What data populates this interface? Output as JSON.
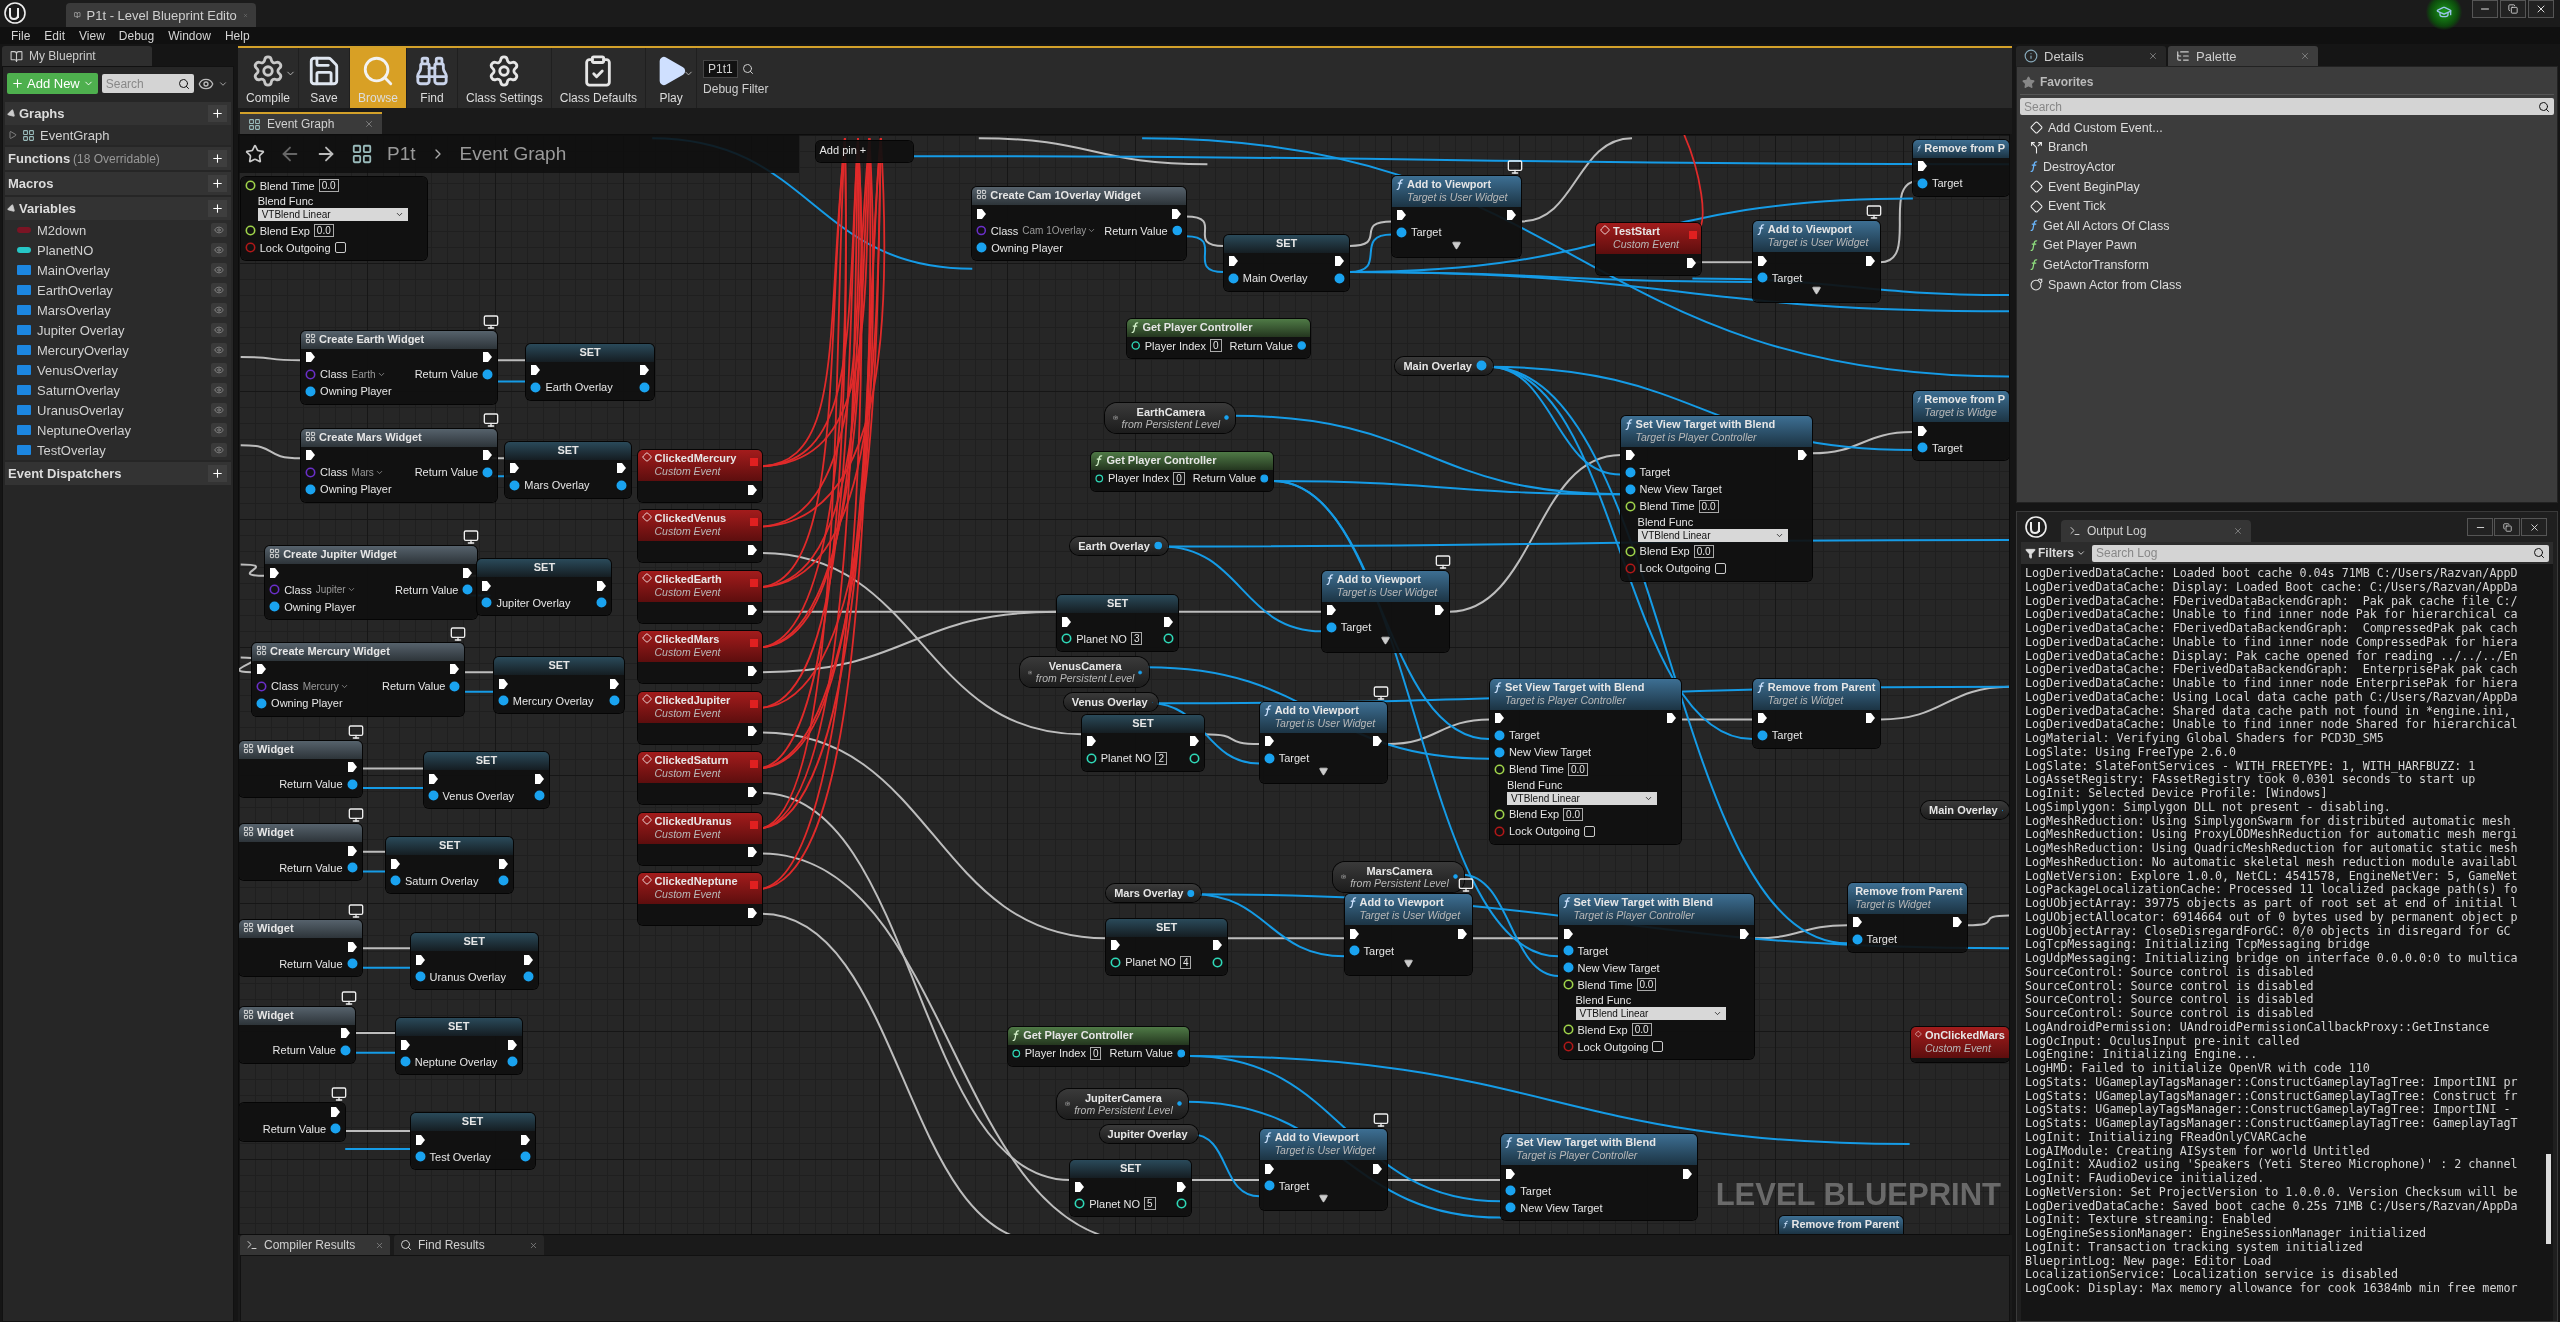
{
  "window": {
    "tab": "P1t - Level Blueprint Edito"
  },
  "menu": [
    "File",
    "Edit",
    "View",
    "Debug",
    "Window",
    "Help"
  ],
  "my_blueprint": {
    "tab": "My Blueprint",
    "add_new": "Add New",
    "search_placeholder": "Search",
    "sections": [
      {
        "title": "Graphs",
        "expanded": true,
        "items": [
          {
            "name": "EventGraph",
            "expanded": false
          }
        ]
      },
      {
        "title": "Functions",
        "note": "(18 Overridable)"
      },
      {
        "title": "Macros"
      },
      {
        "title": "Variables",
        "expanded": true,
        "variables": [
          {
            "name": "M2down",
            "kind": "pill",
            "color": "#7a1424"
          },
          {
            "name": "PlanetNO",
            "kind": "pill",
            "color": "#26c6c6"
          },
          {
            "name": "MainOverlay",
            "kind": "square",
            "color": "#1c86e0"
          },
          {
            "name": "EarthOverlay",
            "kind": "square",
            "color": "#1c86e0"
          },
          {
            "name": "MarsOverlay",
            "kind": "square",
            "color": "#1c86e0"
          },
          {
            "name": "Jupiter Overlay",
            "kind": "square",
            "color": "#1c86e0"
          },
          {
            "name": "MercuryOverlay",
            "kind": "square",
            "color": "#1c86e0"
          },
          {
            "name": "VenusOverlay",
            "kind": "square",
            "color": "#1c86e0"
          },
          {
            "name": "SaturnOverlay",
            "kind": "square",
            "color": "#1c86e0"
          },
          {
            "name": "UranusOverlay",
            "kind": "square",
            "color": "#1c86e0"
          },
          {
            "name": "NeptuneOverlay",
            "kind": "square",
            "color": "#1c86e0"
          },
          {
            "name": "TestOverlay",
            "kind": "square",
            "color": "#1c86e0"
          }
        ]
      },
      {
        "title": "Event Dispatchers"
      }
    ]
  },
  "toolbar": [
    {
      "label": "Compile",
      "kind": "compile",
      "selected": false,
      "menu": true
    },
    {
      "label": "Save",
      "kind": "save",
      "selected": false
    },
    {
      "label": "Browse",
      "kind": "browse",
      "selected": true
    },
    {
      "label": "Find",
      "kind": "find",
      "selected": false
    },
    {
      "label": "Class Settings",
      "kind": "settings",
      "selected": false
    },
    {
      "label": "Class Defaults",
      "kind": "defaults",
      "selected": false
    },
    {
      "label": "Play",
      "kind": "play",
      "selected": false,
      "menu": true
    }
  ],
  "debug_filter": {
    "value": "P1t1",
    "label": "Debug Filter"
  },
  "graph_tab": "Event Graph",
  "breadcrumb": [
    "P1t",
    "Event Graph"
  ],
  "nodes": [
    {
      "kind": "fragment",
      "rows": [
        {
          "in": {
            "label": "Blend Time",
            "kind": "float",
            "value": "0.0"
          }
        },
        {
          "in": {
            "label": "Blend Func",
            "kind": "enum",
            "value": "VTBlend Linear"
          }
        },
        {
          "in": {
            "label": "Blend Exp",
            "kind": "float",
            "value": "0.0"
          }
        },
        {
          "in": {
            "label": "Lock Outgoing",
            "kind": "bool",
            "checked": false
          }
        }
      ]
    },
    {
      "kind": "create",
      "title": "Create Earth Widget",
      "monitor": true,
      "exec_in": true,
      "exec_out": true,
      "rows": [
        {
          "in": {
            "label": "Class",
            "kind": "class",
            "value": "Earth"
          },
          "out": {
            "label": "Return Value",
            "kind": "object"
          }
        },
        {
          "in": {
            "label": "Owning Player",
            "kind": "object"
          }
        }
      ]
    },
    {
      "kind": "set",
      "title": "SET",
      "exec_in": true,
      "exec_out": true,
      "rows": [
        {
          "in": {
            "label": "Earth Overlay",
            "kind": "object"
          },
          "out": {
            "kind": "object"
          }
        }
      ]
    },
    {
      "kind": "create",
      "title": "Create Mars Widget",
      "monitor": true,
      "exec_in": true,
      "exec_out": true,
      "rows": [
        {
          "in": {
            "label": "Class",
            "kind": "class",
            "value": "Mars"
          },
          "out": {
            "label": "Return Value",
            "kind": "object"
          }
        },
        {
          "in": {
            "label": "Owning Player",
            "kind": "object"
          }
        }
      ]
    },
    {
      "kind": "set",
      "title": "SET",
      "exec_in": true,
      "exec_out": true,
      "rows": [
        {
          "in": {
            "label": "Mars Overlay",
            "kind": "object"
          },
          "out": {
            "kind": "object"
          }
        }
      ]
    },
    {
      "kind": "create",
      "title": "Create Jupiter Widget",
      "monitor": true,
      "exec_in": true,
      "exec_out": true,
      "rows": [
        {
          "in": {
            "label": "Class",
            "kind": "class",
            "value": "Jupiter"
          },
          "out": {
            "label": "Return Value",
            "kind": "object"
          }
        },
        {
          "in": {
            "label": "Owning Player",
            "kind": "object"
          }
        }
      ]
    },
    {
      "kind": "set",
      "title": "SET",
      "exec_in": true,
      "exec_out": true,
      "rows": [
        {
          "in": {
            "label": "Jupiter Overlay",
            "kind": "object"
          },
          "out": {
            "kind": "object"
          }
        }
      ]
    },
    {
      "kind": "create",
      "title": "Create Mercury Widget",
      "monitor": true,
      "exec_in": true,
      "exec_out": true,
      "rows": [
        {
          "in": {
            "label": "Class",
            "kind": "class",
            "value": "Mercury"
          },
          "out": {
            "label": "Return Value",
            "kind": "object"
          }
        },
        {
          "in": {
            "label": "Owning Player",
            "kind": "object"
          }
        }
      ]
    },
    {
      "kind": "set",
      "title": "SET",
      "exec_in": true,
      "exec_out": true,
      "rows": [
        {
          "in": {
            "label": "Mercury Overlay",
            "kind": "object"
          },
          "out": {
            "kind": "object"
          }
        }
      ]
    },
    {
      "kind": "create",
      "title": "Widget",
      "monitor": true,
      "exec_in": false,
      "exec_out": true,
      "rows": [
        {
          "out": {
            "label": "Return Value",
            "kind": "object"
          }
        }
      ]
    },
    {
      "kind": "set",
      "title": "SET",
      "exec_in": true,
      "exec_out": true,
      "rows": [
        {
          "in": {
            "label": "Venus Overlay",
            "kind": "object"
          },
          "out": {
            "kind": "object"
          }
        }
      ]
    },
    {
      "kind": "create",
      "title": "Widget",
      "monitor": true,
      "exec_in": false,
      "exec_out": true,
      "rows": [
        {
          "out": {
            "label": "Return Value",
            "kind": "object"
          }
        }
      ]
    },
    {
      "kind": "set",
      "title": "SET",
      "exec_in": true,
      "exec_out": true,
      "rows": [
        {
          "in": {
            "label": "Saturn Overlay",
            "kind": "object"
          },
          "out": {
            "kind": "object"
          }
        }
      ]
    },
    {
      "kind": "create",
      "title": "Widget",
      "monitor": true,
      "exec_in": false,
      "exec_out": true,
      "rows": [
        {
          "out": {
            "label": "Return Value",
            "kind": "object"
          }
        }
      ]
    },
    {
      "kind": "set",
      "title": "SET",
      "exec_in": true,
      "exec_out": true,
      "rows": [
        {
          "in": {
            "label": "Uranus Overlay",
            "kind": "object"
          },
          "out": {
            "kind": "object"
          }
        }
      ]
    },
    {
      "kind": "create",
      "title": "Widget",
      "monitor": true,
      "exec_in": false,
      "exec_out": true,
      "rows": [
        {
          "out": {
            "label": "Return Value",
            "kind": "object"
          }
        }
      ]
    },
    {
      "kind": "set",
      "title": "SET",
      "exec_in": true,
      "exec_out": true,
      "rows": [
        {
          "in": {
            "label": "Neptune Overlay",
            "kind": "object"
          },
          "out": {
            "kind": "object"
          }
        }
      ]
    },
    {
      "kind": "fragment",
      "monitor": true,
      "exec_out": true,
      "rows": [
        {
          "out": {
            "label": "Return Value",
            "kind": "object"
          }
        }
      ]
    },
    {
      "kind": "set",
      "title": "SET",
      "exec_in": true,
      "exec_out": true,
      "rows": [
        {
          "in": {
            "label": "Test Overlay",
            "kind": "object"
          },
          "out": {
            "kind": "object"
          }
        }
      ]
    },
    {
      "kind": "event",
      "title": "ClickedMercury",
      "subtitle": "Custom Event",
      "exec_out": true
    },
    {
      "kind": "event",
      "title": "ClickedVenus",
      "subtitle": "Custom Event",
      "exec_out": true
    },
    {
      "kind": "event",
      "title": "ClickedEarth",
      "subtitle": "Custom Event",
      "exec_out": true
    },
    {
      "kind": "event",
      "title": "ClickedMars",
      "subtitle": "Custom Event",
      "exec_out": true
    },
    {
      "kind": "event",
      "title": "ClickedJupiter",
      "subtitle": "Custom Event",
      "exec_out": true
    },
    {
      "kind": "event",
      "title": "ClickedSaturn",
      "subtitle": "Custom Event",
      "exec_out": true
    },
    {
      "kind": "event",
      "title": "ClickedUranus",
      "subtitle": "Custom Event",
      "exec_out": true
    },
    {
      "kind": "event",
      "title": "ClickedNeptune",
      "subtitle": "Custom Event",
      "exec_out": true
    },
    {
      "kind": "fragment",
      "rows": [
        {
          "in": {
            "label": "Add pin +"
          }
        }
      ]
    },
    {
      "kind": "create",
      "title": "Create Cam 1Overlay Widget",
      "monitor": false,
      "exec_in": true,
      "exec_out": true,
      "rows": [
        {
          "in": {
            "label": "Class",
            "kind": "class",
            "value": "Cam 1Overlay"
          },
          "out": {
            "label": "Return Value",
            "kind": "object"
          }
        },
        {
          "in": {
            "label": "Owning Player",
            "kind": "object"
          }
        }
      ]
    },
    {
      "kind": "set",
      "title": "SET",
      "exec_in": true,
      "exec_out": true,
      "rows": [
        {
          "in": {
            "label": "Main Overlay",
            "kind": "object"
          },
          "out": {
            "kind": "object"
          }
        }
      ]
    },
    {
      "kind": "func",
      "title": "Add to Viewport",
      "subtitle": "Target is User Widget",
      "monitor": true,
      "advanced": true,
      "exec_in": true,
      "exec_out": true,
      "rows": [
        {
          "in": {
            "label": "Target",
            "kind": "object"
          }
        }
      ]
    },
    {
      "kind": "event",
      "title": "TestStart",
      "subtitle": "Custom Event",
      "exec_out": true
    },
    {
      "kind": "func",
      "title": "Add to Viewport",
      "subtitle": "Target is User Widget",
      "monitor": true,
      "advanced": true,
      "exec_in": true,
      "exec_out": true,
      "rows": [
        {
          "in": {
            "label": "Target",
            "kind": "object"
          }
        }
      ]
    },
    {
      "kind": "func",
      "title": "Remove from P",
      "exec_in": true,
      "exec_out": false,
      "rows": [
        {
          "in": {
            "label": "Target",
            "kind": "object"
          }
        }
      ]
    },
    {
      "kind": "pure",
      "title": "Get Player Controller",
      "rows": [
        {
          "in": {
            "label": "Player Index",
            "kind": "int",
            "value": "0"
          },
          "out": {
            "label": "Return Value",
            "kind": "object"
          }
        }
      ]
    },
    {
      "kind": "var",
      "title": "Main Overlay"
    },
    {
      "kind": "var",
      "title": "EarthCamera",
      "subtitle": "from Persistent Level"
    },
    {
      "kind": "pure",
      "title": "Get Player Controller",
      "rows": [
        {
          "in": {
            "label": "Player Index",
            "kind": "int",
            "value": "0"
          },
          "out": {
            "label": "Return Value",
            "kind": "object"
          }
        }
      ]
    },
    {
      "kind": "func",
      "title": "Set View Target with Blend",
      "subtitle": "Target is Player Controller",
      "exec_in": true,
      "exec_out": true,
      "rows": [
        {
          "in": {
            "label": "Target",
            "kind": "object"
          }
        },
        {
          "in": {
            "label": "New View Target",
            "kind": "object"
          }
        },
        {
          "in": {
            "label": "Blend Time",
            "kind": "float",
            "value": "0.0"
          }
        },
        {
          "in": {
            "label": "Blend Func",
            "kind": "enum",
            "value": "VTBlend Linear"
          }
        },
        {
          "in": {
            "label": "Blend Exp",
            "kind": "float",
            "value": "0.0"
          }
        },
        {
          "in": {
            "label": "Lock Outgoing",
            "kind": "bool",
            "checked": false
          }
        }
      ]
    },
    {
      "kind": "func",
      "title": "Remove from P",
      "subtitle": "Target is Widge",
      "exec_in": true,
      "exec_out": false,
      "rows": [
        {
          "in": {
            "label": "Target",
            "kind": "object"
          }
        }
      ]
    },
    {
      "kind": "var",
      "title": "Earth Overlay"
    },
    {
      "kind": "set",
      "title": "SET",
      "exec_in": true,
      "exec_out": true,
      "rows": [
        {
          "in": {
            "label": "Planet NO",
            "kind": "int",
            "value": "3"
          },
          "out": {
            "kind": "int"
          }
        }
      ]
    },
    {
      "kind": "func",
      "title": "Add to Viewport",
      "subtitle": "Target is User Widget",
      "monitor": true,
      "advanced": true,
      "exec_in": true,
      "exec_out": true,
      "rows": [
        {
          "in": {
            "label": "Target",
            "kind": "object"
          }
        }
      ]
    },
    {
      "kind": "var",
      "title": "VenusCamera",
      "subtitle": "from Persistent Level"
    },
    {
      "kind": "var",
      "title": "Venus Overlay"
    },
    {
      "kind": "set",
      "title": "SET",
      "exec_in": true,
      "exec_out": true,
      "rows": [
        {
          "in": {
            "label": "Planet NO",
            "kind": "int",
            "value": "2"
          },
          "out": {
            "kind": "int"
          }
        }
      ]
    },
    {
      "kind": "func",
      "title": "Add to Viewport",
      "subtitle": "Target is User Widget",
      "monitor": true,
      "advanced": true,
      "exec_in": true,
      "exec_out": true,
      "rows": [
        {
          "in": {
            "label": "Target",
            "kind": "object"
          }
        }
      ]
    },
    {
      "kind": "func",
      "title": "Set View Target with Blend",
      "subtitle": "Target is Player Controller",
      "exec_in": true,
      "exec_out": true,
      "rows": [
        {
          "in": {
            "label": "Target",
            "kind": "object"
          }
        },
        {
          "in": {
            "label": "New View Target",
            "kind": "object"
          }
        },
        {
          "in": {
            "label": "Blend Time",
            "kind": "float",
            "value": "0.0"
          }
        },
        {
          "in": {
            "label": "Blend Func",
            "kind": "enum",
            "value": "VTBlend Linear"
          }
        },
        {
          "in": {
            "label": "Blend Exp",
            "kind": "float",
            "value": "0.0"
          }
        },
        {
          "in": {
            "label": "Lock Outgoing",
            "kind": "bool",
            "checked": false
          }
        }
      ]
    },
    {
      "kind": "func",
      "title": "Remove from Parent",
      "subtitle": "Target is Widget",
      "exec_in": true,
      "exec_out": true,
      "rows": [
        {
          "in": {
            "label": "Target",
            "kind": "object"
          }
        }
      ]
    },
    {
      "kind": "var",
      "title": "Main Overlay"
    },
    {
      "kind": "var",
      "title": "MarsCamera",
      "subtitle": "from Persistent Level"
    },
    {
      "kind": "var",
      "title": "Mars Overlay"
    },
    {
      "kind": "set",
      "title": "SET",
      "exec_in": true,
      "exec_out": true,
      "rows": [
        {
          "in": {
            "label": "Planet NO",
            "kind": "int",
            "value": "4"
          },
          "out": {
            "kind": "int"
          }
        }
      ]
    },
    {
      "kind": "func",
      "title": "Add to Viewport",
      "subtitle": "Target is User Widget",
      "monitor": true,
      "advanced": true,
      "exec_in": true,
      "exec_out": true,
      "rows": [
        {
          "in": {
            "label": "Target",
            "kind": "object"
          }
        }
      ]
    },
    {
      "kind": "func",
      "title": "Set View Target with Blend",
      "subtitle": "Target is Player Controller",
      "exec_in": true,
      "exec_out": true,
      "rows": [
        {
          "in": {
            "label": "Target",
            "kind": "object"
          }
        },
        {
          "in": {
            "label": "New View Target",
            "kind": "object"
          }
        },
        {
          "in": {
            "label": "Blend Time",
            "kind": "float",
            "value": "0.0"
          }
        },
        {
          "in": {
            "label": "Blend Func",
            "kind": "enum",
            "value": "VTBlend Linear"
          }
        },
        {
          "in": {
            "label": "Blend Exp",
            "kind": "float",
            "value": "0.0"
          }
        },
        {
          "in": {
            "label": "Lock Outgoing",
            "kind": "bool",
            "checked": false
          }
        }
      ]
    },
    {
      "kind": "func",
      "title": "Remove from Parent",
      "subtitle": "Target is Widget",
      "exec_in": true,
      "exec_out": true,
      "rows": [
        {
          "in": {
            "label": "Target",
            "kind": "object"
          }
        }
      ]
    },
    {
      "kind": "pure",
      "title": "Get Player Controller",
      "rows": [
        {
          "in": {
            "label": "Player Index",
            "kind": "int",
            "value": "0"
          },
          "out": {
            "label": "Return Value",
            "kind": "object"
          }
        }
      ]
    },
    {
      "kind": "event",
      "title": "OnClickedMars",
      "subtitle": "Custom Event"
    },
    {
      "kind": "var",
      "title": "JupiterCamera",
      "subtitle": "from Persistent Level"
    },
    {
      "kind": "var",
      "title": "Jupiter Overlay"
    },
    {
      "kind": "set",
      "title": "SET",
      "exec_in": true,
      "exec_out": true,
      "rows": [
        {
          "in": {
            "label": "Planet NO",
            "kind": "int",
            "value": "5"
          },
          "out": {
            "kind": "int"
          }
        }
      ]
    },
    {
      "kind": "func",
      "title": "Add to Viewport",
      "subtitle": "Target is User Widget",
      "monitor": true,
      "advanced": true,
      "exec_in": true,
      "exec_out": true,
      "rows": [
        {
          "in": {
            "label": "Target",
            "kind": "object"
          }
        }
      ]
    },
    {
      "kind": "func",
      "title": "Set View Target with Blend",
      "subtitle": "Target is Player Controller",
      "exec_in": true,
      "exec_out": true,
      "rows": [
        {
          "in": {
            "label": "Target",
            "kind": "object"
          }
        },
        {
          "in": {
            "label": "New View Target",
            "kind": "object"
          }
        }
      ]
    },
    {
      "kind": "func",
      "title": "Remove from Parent"
    }
  ],
  "graph_label": "LEVEL BLUEPRINT",
  "bottom_tabs": [
    {
      "label": "Compiler Results",
      "selected": true
    },
    {
      "label": "Find Results",
      "selected": false
    }
  ],
  "right_tabs": [
    {
      "label": "Details",
      "selected": false
    },
    {
      "label": "Palette",
      "selected": true
    }
  ],
  "palette": {
    "header": "Favorites",
    "search_placeholder": "Search",
    "items": [
      {
        "label": "Add Custom Event...",
        "kind": "event"
      },
      {
        "label": "Branch",
        "kind": "branch"
      },
      {
        "label": "DestroyActor",
        "kind": "function"
      },
      {
        "label": "Event BeginPlay",
        "kind": "event"
      },
      {
        "label": "Event Tick",
        "kind": "event"
      },
      {
        "label": "Get All Actors Of Class",
        "kind": "function"
      },
      {
        "label": "Get Player Pawn",
        "kind": "pure"
      },
      {
        "label": "GetActorTransform",
        "kind": "pure"
      },
      {
        "label": "Spawn Actor from Class",
        "kind": "spawn"
      }
    ]
  },
  "output_log": {
    "tab": "Output Log",
    "filters": "Filters",
    "search_placeholder": "Search Log",
    "lines": [
      "LogDerivedDataCache: Loaded boot cache 0.04s 71MB C:/Users/Razvan/AppD",
      "LogDerivedDataCache: Display: Loaded Boot cache: C:/Users/Razvan/AppDa",
      "LogDerivedDataCache: FDerivedDataBackendGraph:  Pak pak cache file C:/",
      "LogDerivedDataCache: Unable to find inner node Pak for hierarchical ca",
      "LogDerivedDataCache: FDerivedDataBackendGraph:  CompressedPak pak cach",
      "LogDerivedDataCache: Unable to find inner node CompressedPak for hiera",
      "LogDerivedDataCache: Display: Pak cache opened for reading ../../../En",
      "LogDerivedDataCache: FDerivedDataBackendGraph:  EnterprisePak pak cach",
      "LogDerivedDataCache: Unable to find inner node EnterprisePak for hiera",
      "LogDerivedDataCache: Using Local data cache path C:/Users/Razvan/AppDa",
      "LogDerivedDataCache: Shared data cache path not found in *engine.ini,",
      "LogDerivedDataCache: Unable to find inner node Shared for hierarchical",
      "LogMaterial: Verifying Global Shaders for PCD3D_SM5",
      "LogSlate: Using FreeType 2.6.0",
      "LogSlate: SlateFontServices - WITH_FREETYPE: 1, WITH_HARFBUZZ: 1",
      "LogAssetRegistry: FAssetRegistry took 0.0301 seconds to start up",
      "LogInit: Selected Device Profile: [Windows]",
      "LogSimplygon: Simplygon DLL not present - disabling.",
      "LogMeshReduction: Using SimplygonSwarm for distributed automatic mesh",
      "LogMeshReduction: Using ProxyLODMeshReduction for automatic mesh mergi",
      "LogMeshReduction: Using QuadricMeshReduction for automatic static mesh",
      "LogMeshReduction: No automatic skeletal mesh reduction module availabl",
      "LogNetVersion: Explore 1.0.0, NetCL: 4541578, EngineNetVer: 5, GameNet",
      "LogPackageLocalizationCache: Processed 11 localized package path(s) fo",
      "LogUObjectArray: 39775 objects as part of root set at end of initial l",
      "LogUObjectAllocator: 6914664 out of 0 bytes used by permanent object p",
      "LogUObjectArray: CloseDisregardForGC: 0/0 objects in disregard for GC",
      "LogTcpMessaging: Initializing TcpMessaging bridge",
      "LogUdpMessaging: Initializing bridge on interface 0.0.0.0:0 to multica",
      "SourceControl: Source control is disabled",
      "SourceControl: Source control is disabled",
      "SourceControl: Source control is disabled",
      "SourceControl: Source control is disabled",
      "LogAndroidPermission: UAndroidPermissionCallbackProxy::GetInstance",
      "LogOcInput: OculusInput pre-init called",
      "LogEngine: Initializing Engine...",
      "LogHMD: Failed to initialize OpenVR with code 110",
      "LogStats: UGameplayTagsManager::ConstructGameplayTagTree: ImportINI pr",
      "LogStats: UGameplayTagsManager::ConstructGameplayTagTree: Construct fr",
      "LogStats: UGameplayTagsManager::ConstructGameplayTagTree: ImportINI -",
      "LogStats: UGameplayTagsManager::ConstructGameplayTagTree: GameplayTagT",
      "LogInit: Initializing FReadOnlyCVARCache",
      "LogAIModule: Creating AISystem for world Untitled",
      "LogInit: XAudio2 using 'Speakers (Yeti Stereo Microphone)' : 2 channel",
      "LogInit: FAudioDevice initialized.",
      "LogNetVersion: Set ProjectVersion to 1.0.0.0. Version Checksum will be",
      "LogDerivedDataCache: Saved boot cache 0.25s 71MB C:/Users/Razvan/AppDa",
      "LogInit: Texture streaming: Enabled",
      "LogEngineSessionManager: EngineSessionManager initialized",
      "LogInit: Transaction tracking system initialized",
      "BlueprintLog: New page: Editor Load",
      "LocalizationService: Localization service is disabled",
      "LogCook: Display: Max memory allowance for cook 16384mb min free memor"
    ]
  }
}
